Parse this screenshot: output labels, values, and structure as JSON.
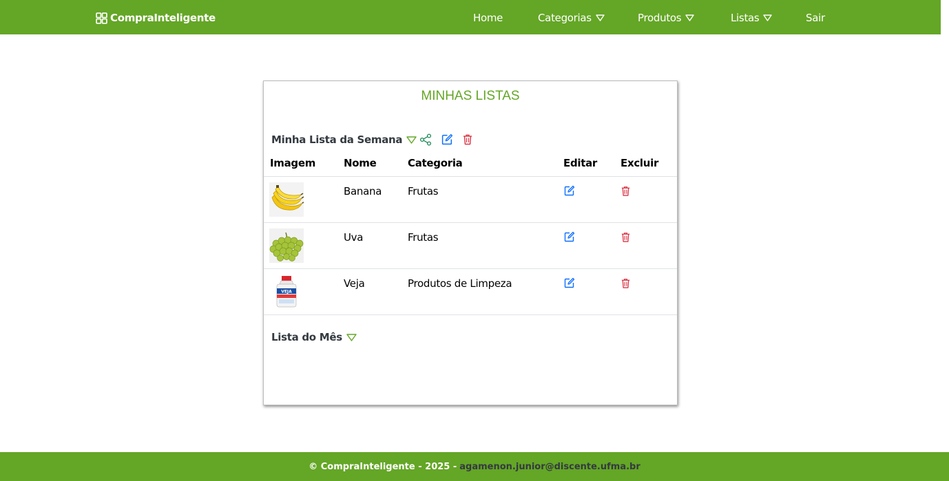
{
  "navbar": {
    "brand": "CompraInteligente",
    "items": [
      {
        "label": "Home"
      },
      {
        "label": "Categorias"
      },
      {
        "label": "Produtos"
      },
      {
        "label": "Listas"
      },
      {
        "label": "Sair"
      }
    ]
  },
  "card": {
    "title": "MINHAS LISTAS",
    "lists": [
      {
        "name": "Minha Lista da Semana",
        "expanded": true,
        "columns": [
          "Imagem",
          "Nome",
          "Categoria",
          "Editar",
          "Excluir"
        ],
        "rows": [
          {
            "image": "banana-image",
            "name": "Banana",
            "category": "Frutas"
          },
          {
            "image": "grapes-image",
            "name": "Uva",
            "category": "Frutas"
          },
          {
            "image": "veja-bottle-image",
            "name": "Veja",
            "category": "Produtos de Limpeza"
          }
        ]
      },
      {
        "name": "Lista do Mês",
        "expanded": false
      }
    ]
  },
  "footer": {
    "text": "© CompraInteligente - 2025 -",
    "email": "agamenon.junior@discente.ufma.br"
  },
  "colors": {
    "brand_green": "#64a626",
    "edit_blue": "#0d6efd",
    "delete_red": "#dc3545",
    "share_green": "#198754"
  }
}
